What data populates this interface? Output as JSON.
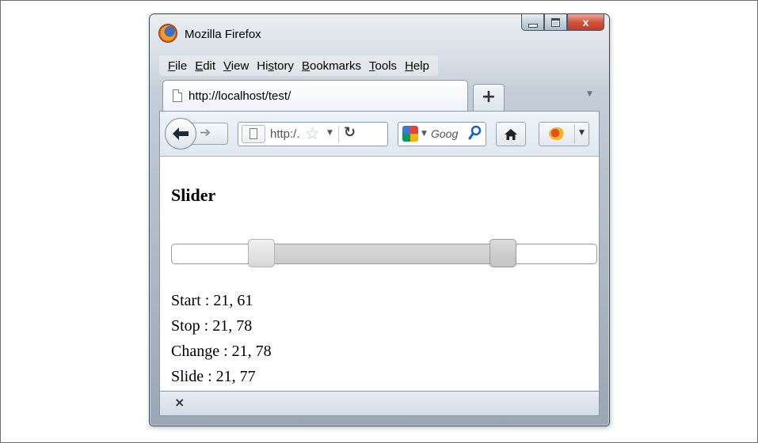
{
  "window": {
    "title": "Mozilla Firefox",
    "close_glyph": "x"
  },
  "menubar": {
    "items": [
      {
        "pre": "",
        "key": "F",
        "post": "ile"
      },
      {
        "pre": "",
        "key": "E",
        "post": "dit"
      },
      {
        "pre": "",
        "key": "V",
        "post": "iew"
      },
      {
        "pre": "Hi",
        "key": "s",
        "post": "tory"
      },
      {
        "pre": "",
        "key": "B",
        "post": "ookmarks"
      },
      {
        "pre": "",
        "key": "T",
        "post": "ools"
      },
      {
        "pre": "",
        "key": "H",
        "post": "elp"
      }
    ]
  },
  "tab": {
    "title": "http://localhost/test/",
    "new_tab_label": "+"
  },
  "navbar": {
    "url_text": "http:/.",
    "search_placeholder": "Goog"
  },
  "content": {
    "heading": "Slider",
    "slider": {
      "start_value": 21,
      "end_value": 78,
      "min": 0,
      "max": 100
    },
    "log": [
      "Start : 21, 61",
      "Stop : 21, 78",
      "Change : 21, 78",
      "Slide : 21, 77"
    ]
  },
  "statusbar": {
    "close_glyph": "×"
  },
  "icons": {
    "logo": "firefox-logo-icon",
    "back": "back-arrow-icon",
    "forward": "forward-arrow-icon",
    "bookmark": "star-icon",
    "reload": "reload-icon",
    "search_engine": "google-icon",
    "search": "search-icon",
    "home": "home-icon",
    "addon": "addon-bug-icon"
  }
}
